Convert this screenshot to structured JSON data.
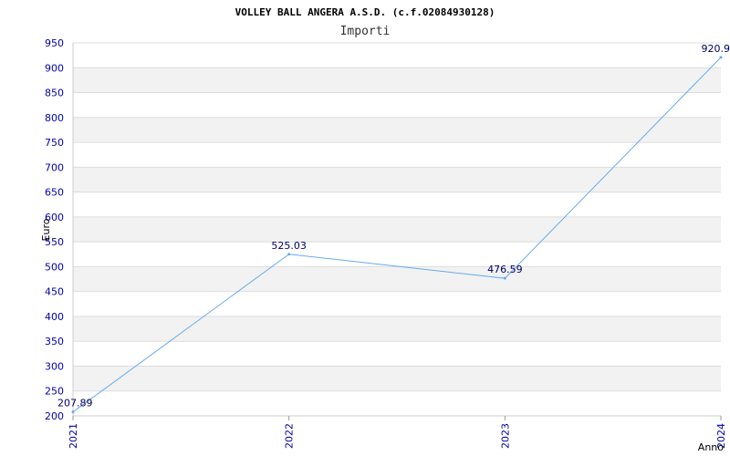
{
  "chart_data": {
    "type": "line",
    "title": "VOLLEY BALL ANGERA A.S.D. (c.f.02084930128)",
    "subtitle": "Importi",
    "xlabel": "Anno",
    "ylabel": "Euro",
    "categories": [
      "2021",
      "2022",
      "2023",
      "2024"
    ],
    "series": [
      {
        "values": [
          207.89,
          525.03,
          476.59,
          920.9
        ]
      }
    ],
    "data_labels": [
      "207.89",
      "525.03",
      "476.59",
      "920.9"
    ],
    "ylim": [
      200,
      950
    ],
    "yticks": [
      200,
      250,
      300,
      350,
      400,
      450,
      500,
      550,
      600,
      650,
      700,
      750,
      800,
      850,
      900,
      950
    ],
    "grid": true,
    "colors": {
      "line": "#66aaee",
      "band": "#f2f2f2",
      "tick": "#0000aa",
      "gridline": "#dddddd"
    }
  }
}
